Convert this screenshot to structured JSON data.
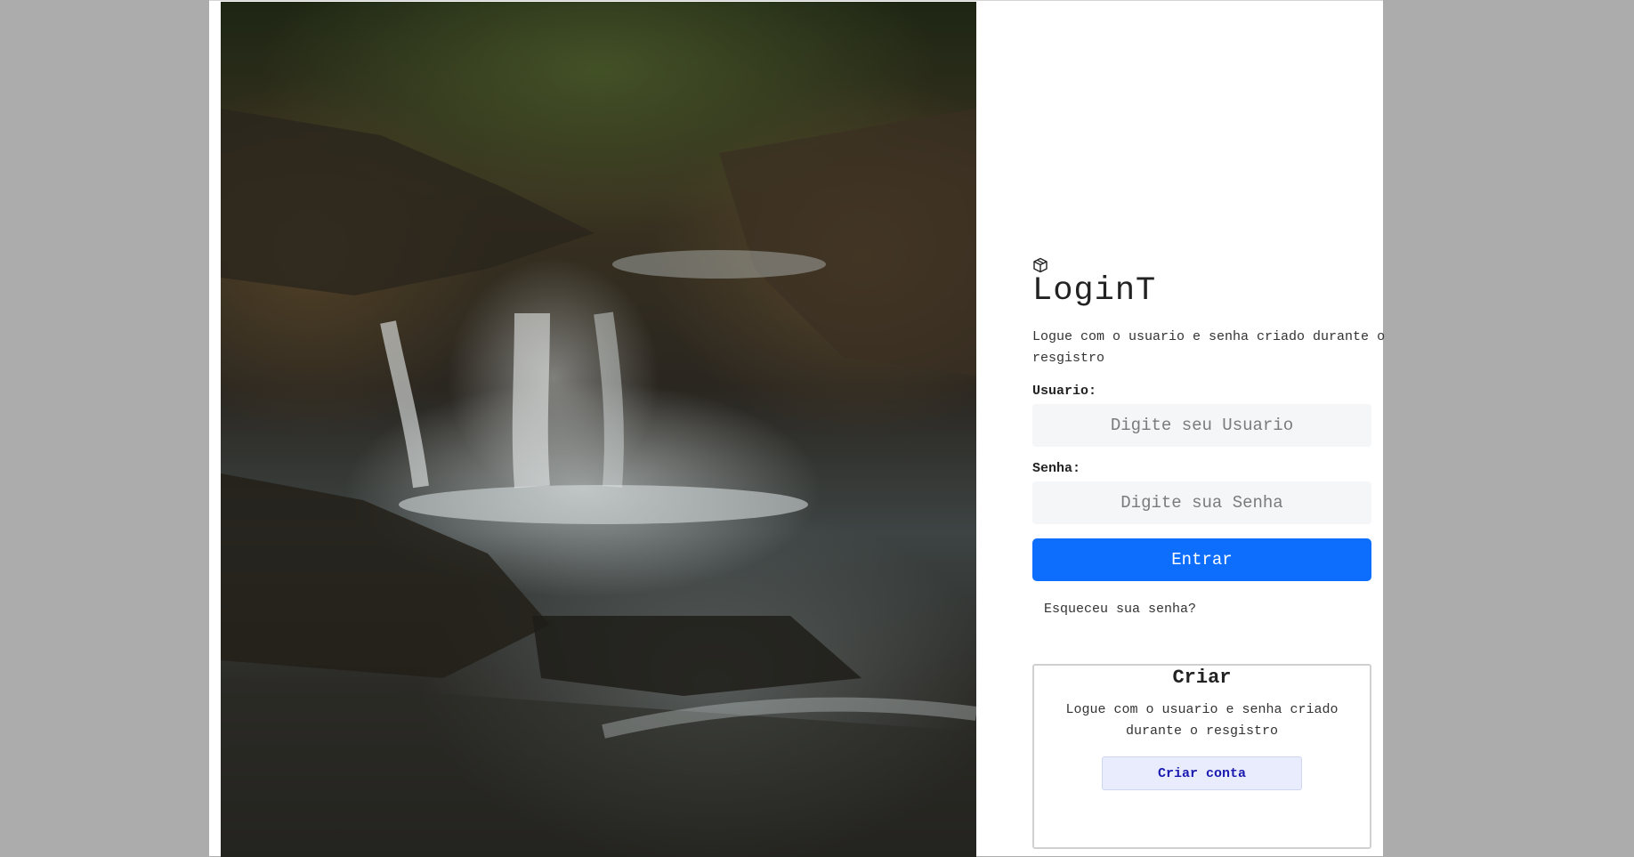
{
  "brand": {
    "icon": "box-icon",
    "title": "LoginT"
  },
  "login": {
    "subtitle": "Logue com o usuario e senha criado durante o resgistro",
    "user_label": "Usuario:",
    "user_placeholder": "Digite seu Usuario",
    "password_label": "Senha:",
    "password_placeholder": "Digite sua Senha",
    "submit_label": "Entrar",
    "forgot_label": "Esqueceu sua senha?"
  },
  "create": {
    "title": "Criar",
    "text": "Logue com o usuario e senha criado durante o resgistro",
    "button_label": "Criar conta"
  },
  "colors": {
    "primary": "#0d6efd",
    "secondary_bg": "#e8ecfc",
    "secondary_text": "#1a1ab0"
  }
}
